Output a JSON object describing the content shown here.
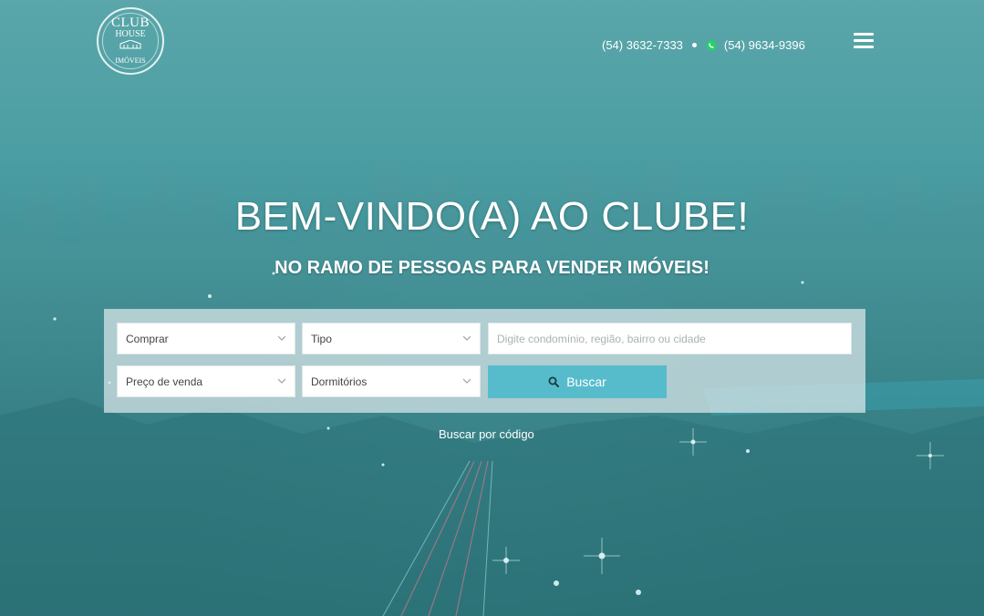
{
  "header": {
    "logo": {
      "line1": "CLUB",
      "line2": "HOUSE",
      "line3": "IMÓVEIS"
    },
    "phone1": "(54) 3632-7333",
    "phone2": "(54) 9634-9396",
    "menu_icon": "hamburger-icon",
    "whatsapp_icon": "whatsapp-icon"
  },
  "hero": {
    "title": "BEM-VINDO(A) AO CLUBE!",
    "subtitle": "NO RAMO DE PESSOAS PARA VENDER IMÓVEIS!"
  },
  "search": {
    "operation": "Comprar",
    "type": "Tipo",
    "location_placeholder": "Digite condomínio, região, bairro ou cidade",
    "price": "Preço de venda",
    "bedrooms": "Dormitórios",
    "submit_label": "Buscar",
    "submit_icon": "search-icon",
    "code_link": "Buscar por código"
  },
  "colors": {
    "accent": "#56bccb",
    "background_tint": "#3f9096",
    "whatsapp": "#25d366"
  }
}
